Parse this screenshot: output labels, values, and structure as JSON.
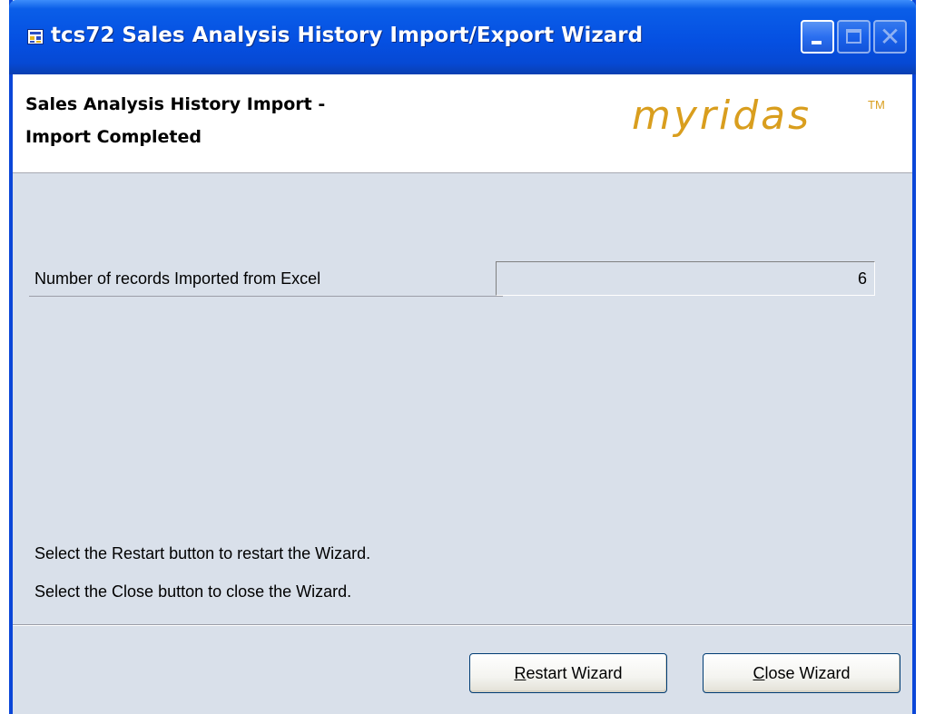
{
  "window": {
    "title": "tcs72 Sales Analysis History Import/Export Wizard",
    "icons": {
      "app": "app-icon",
      "minimize": "minimize-icon",
      "maximize": "maximize-icon",
      "close": "close-icon"
    }
  },
  "header": {
    "line1": "Sales Analysis History Import -",
    "line2": "Import Completed",
    "logo_text": "myridas",
    "logo_tm": "TM"
  },
  "form": {
    "records_label": "Number of records Imported from Excel",
    "records_value": "6"
  },
  "instructions": {
    "restart": "Select the Restart button to restart the Wizard.",
    "close": "Select the Close button to close the Wizard."
  },
  "buttons": {
    "restart_mnemonic": "R",
    "restart_rest": "estart Wizard",
    "close_mnemonic": "C",
    "close_rest": "lose Wizard"
  },
  "colors": {
    "titlebar": "#0550e2",
    "body": "#d9e0ea",
    "logo": "#d99e1e"
  }
}
